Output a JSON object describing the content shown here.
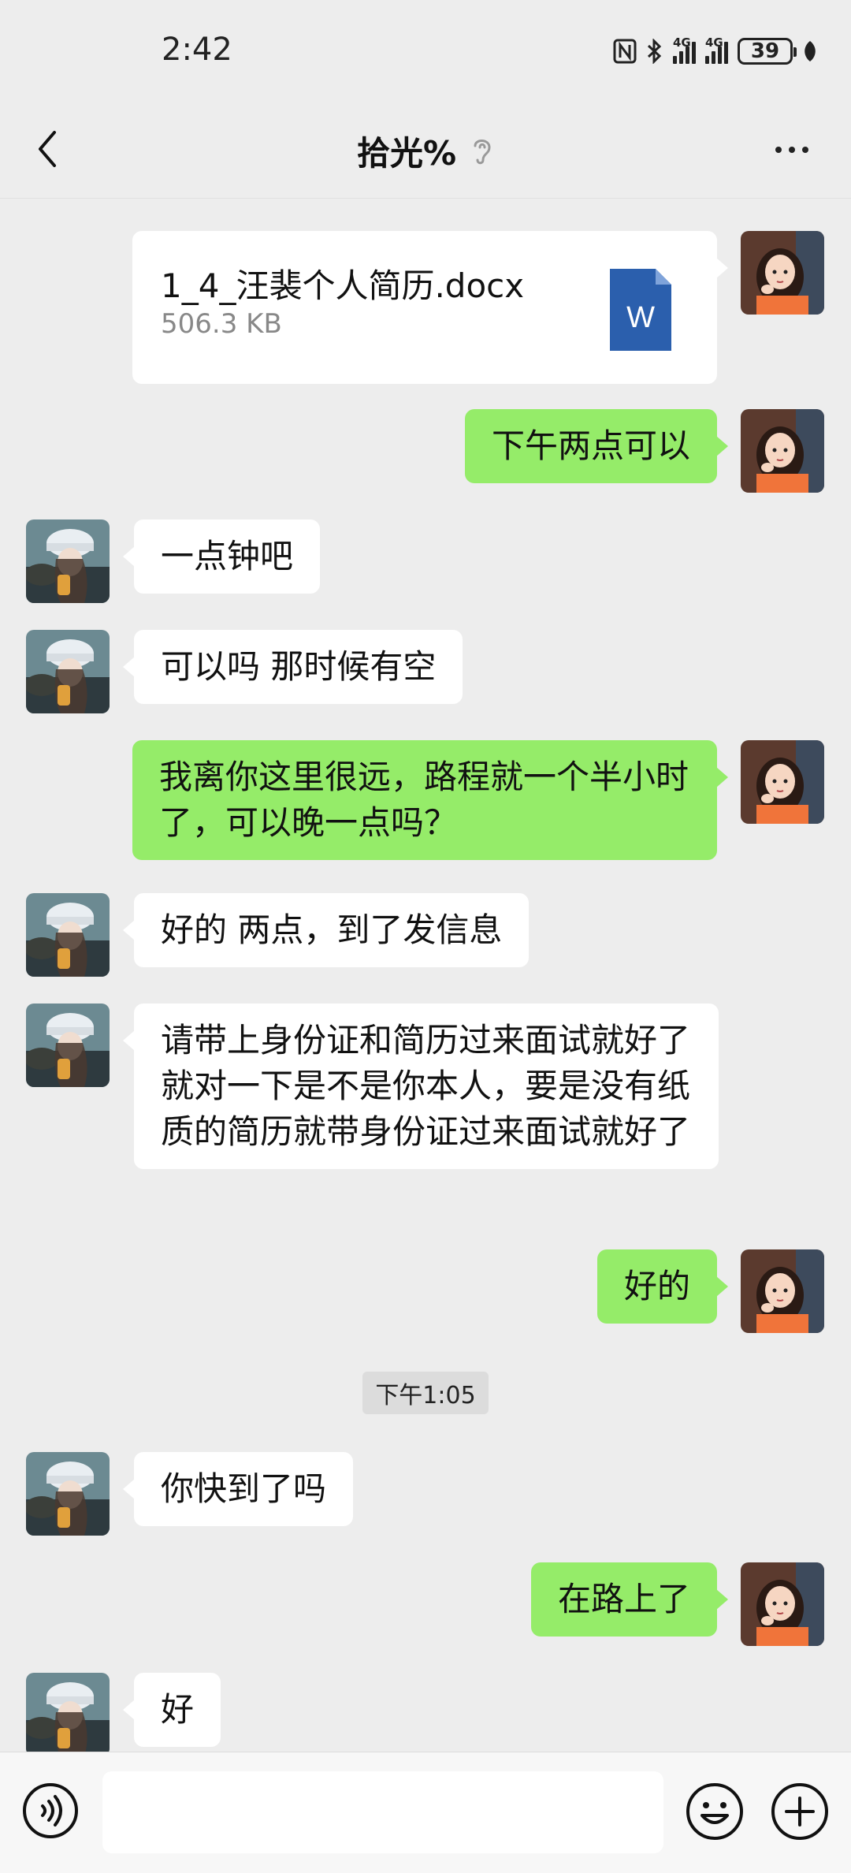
{
  "status_bar": {
    "time": "2:42",
    "net1": "4G",
    "net2": "4G",
    "battery": "39"
  },
  "header": {
    "title": "拾光%",
    "icons": [
      "back-icon",
      "ear-icon",
      "more-icon"
    ]
  },
  "file_message": {
    "name": "1_4_汪裴个人简历.docx",
    "size": "506.3 KB",
    "icon_letter": "W"
  },
  "messages": [
    {
      "side": "out",
      "text": "下午两点可以"
    },
    {
      "side": "in",
      "text": "一点钟吧"
    },
    {
      "side": "in",
      "text": "可以吗 那时候有空"
    },
    {
      "side": "out",
      "text": "我离你这里很远，路程就一个半小时了，可以晚一点吗？"
    },
    {
      "side": "in",
      "text": "好的 两点，到了发信息"
    },
    {
      "side": "in",
      "text": "请带上身份证和简历过来面试就好了 就对一下是不是你本人，要是没有纸质的简历就带身份证过来面试就好了"
    },
    {
      "side": "out",
      "text": "好的"
    },
    {
      "side": "in",
      "text": "你快到了吗"
    },
    {
      "side": "out",
      "text": "在路上了"
    },
    {
      "side": "in",
      "text": "好"
    }
  ],
  "timestamp": "下午1:05",
  "input_bar": {
    "placeholder": "",
    "icons": [
      "voice-icon",
      "emoji-icon",
      "plus-icon"
    ]
  },
  "colors": {
    "outgoing_bubble": "#95ec69",
    "incoming_bubble": "#ffffff",
    "background": "#ededed",
    "word_icon": "#2b5fad"
  }
}
